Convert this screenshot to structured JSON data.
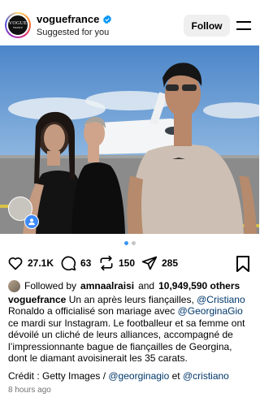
{
  "header": {
    "avatar_text_main": "VOGUE",
    "avatar_text_sub": "FRANCE",
    "username": "voguefrance",
    "subtitle": "Suggested for you",
    "follow_label": "Follow"
  },
  "icons": {
    "verified": "verified-badge-icon",
    "menu": "menu-icon",
    "heart": "heart-icon",
    "comment": "comment-icon",
    "repost": "repost-icon",
    "share": "send-icon",
    "save": "bookmark-icon",
    "tag": "user-tag-icon"
  },
  "colors": {
    "accent": "#3897f0",
    "mention": "#00376b",
    "muted": "#737373",
    "button_bg": "#efefef"
  },
  "carousel": {
    "count": 2,
    "active_index": 0
  },
  "actions": {
    "likes_count": "27.1K",
    "comments_count": "63",
    "reposts_count": "150",
    "shares_count": "285"
  },
  "likes_line": {
    "prefix": "Followed by",
    "follower": "amnaalraisi",
    "and": "and",
    "others": "10,949,590 others"
  },
  "caption": {
    "username": "voguefrance",
    "part1": " Un an après leurs fiançailles, ",
    "mention1": "@Cristiano",
    "part2": " Ronaldo a officialisé son mariage avec ",
    "mention2": "@GeorginaGio",
    "part3": " ce mardi sur Instagram. Le footballeur et sa femme ont dévoilé un cliché de leurs alliances, accompagné de l’impressionnante bague de fiançailles de Georgina, dont le diamant avoisinerait les 35 carats."
  },
  "credit": {
    "prefix": "Crédit : Getty Images / ",
    "mention1": "@georginagio",
    "middle": " et ",
    "mention2": "@cristiano"
  },
  "time_ago": "8 hours ago"
}
